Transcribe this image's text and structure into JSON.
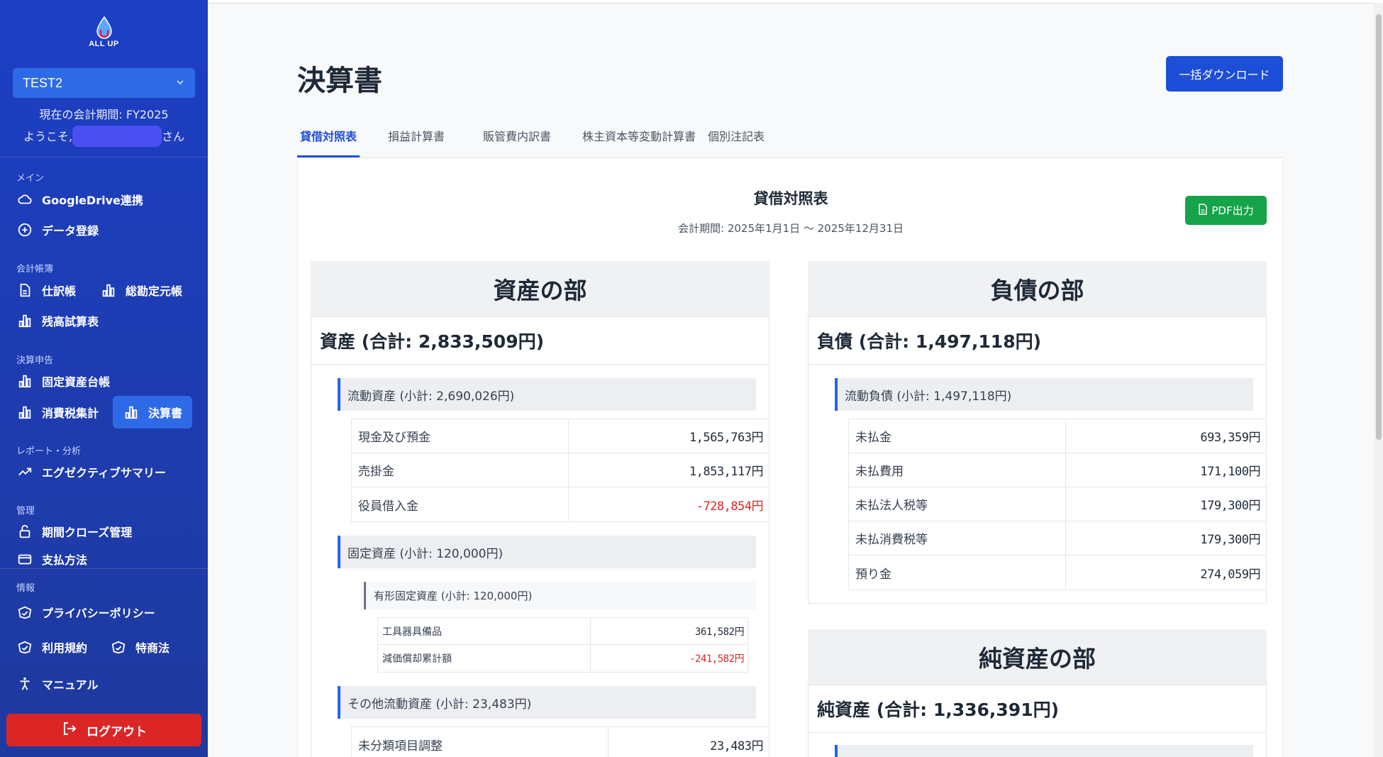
{
  "sidebar": {
    "brand": "ALL UP",
    "company": "TEST2",
    "period": "現在の会計期間: FY2025",
    "welcome_prefix": "ようこそ,",
    "welcome_suffix": "さん",
    "sections": {
      "main": "メイン",
      "ledger": "会計帳簿",
      "closing": "決算申告",
      "report": "レポート・分析",
      "manage": "管理",
      "info": "情報"
    },
    "items": {
      "gdrive": "GoogleDrive連携",
      "data_entry": "データ登録",
      "journal": "仕訳帳",
      "general_ledger": "総勘定元帳",
      "trial_balance": "残高試算表",
      "fixed_assets": "固定資産台帳",
      "consumption_tax": "消費税集計",
      "statements": "決算書",
      "exec_summary": "エグゼクティブサマリー",
      "period_close": "期間クローズ管理",
      "payment": "支払方法",
      "privacy": "プライバシーポリシー",
      "terms": "利用規約",
      "tokushoho": "特商法",
      "manual": "マニュアル"
    },
    "logout": "ログアウト"
  },
  "header": {
    "title": "決算書",
    "bulk_download": "一括ダウンロード"
  },
  "tabs": [
    "貸借対照表",
    "損益計算書",
    "販管費内訳書",
    "株主資本等変動計算書",
    "個別注記表"
  ],
  "report": {
    "title": "貸借対照表",
    "period": "会計期間: 2025年1月1日 〜 2025年12月31日",
    "pdf_button": "PDF出力",
    "assets": {
      "heading": "資産の部",
      "total": "資産 (合計: 2,833,509円)",
      "current": {
        "label": "流動資産 (小計: 2,690,026円)",
        "rows": [
          {
            "name": "現金及び預金",
            "value": "1,565,763円"
          },
          {
            "name": "売掛金",
            "value": "1,853,117円"
          },
          {
            "name": "役員借入金",
            "value": "-728,854円"
          }
        ]
      },
      "fixed": {
        "label": "固定資産 (小計: 120,000円)",
        "tangible_label": "有形固定資産 (小計: 120,000円)",
        "rows": [
          {
            "name": "工具器具備品",
            "value": "361,582円"
          },
          {
            "name": "減価償却累計額",
            "value": "-241,582円"
          }
        ]
      },
      "other": {
        "label": "その他流動資産 (小計: 23,483円)",
        "rows": [
          {
            "name": "未分類項目調整",
            "value": "23,483円"
          }
        ]
      }
    },
    "liabilities": {
      "heading": "負債の部",
      "total": "負債 (合計: 1,497,118円)",
      "current": {
        "label": "流動負債 (小計: 1,497,118円)",
        "rows": [
          {
            "name": "未払金",
            "value": "693,359円"
          },
          {
            "name": "未払費用",
            "value": "171,100円"
          },
          {
            "name": "未払法人税等",
            "value": "179,300円"
          },
          {
            "name": "未払消費税等",
            "value": "179,300円"
          },
          {
            "name": "預り金",
            "value": "274,059円"
          }
        ]
      }
    },
    "net_assets": {
      "heading": "純資産の部",
      "total": "純資産 (合計: 1,336,391円)"
    }
  }
}
